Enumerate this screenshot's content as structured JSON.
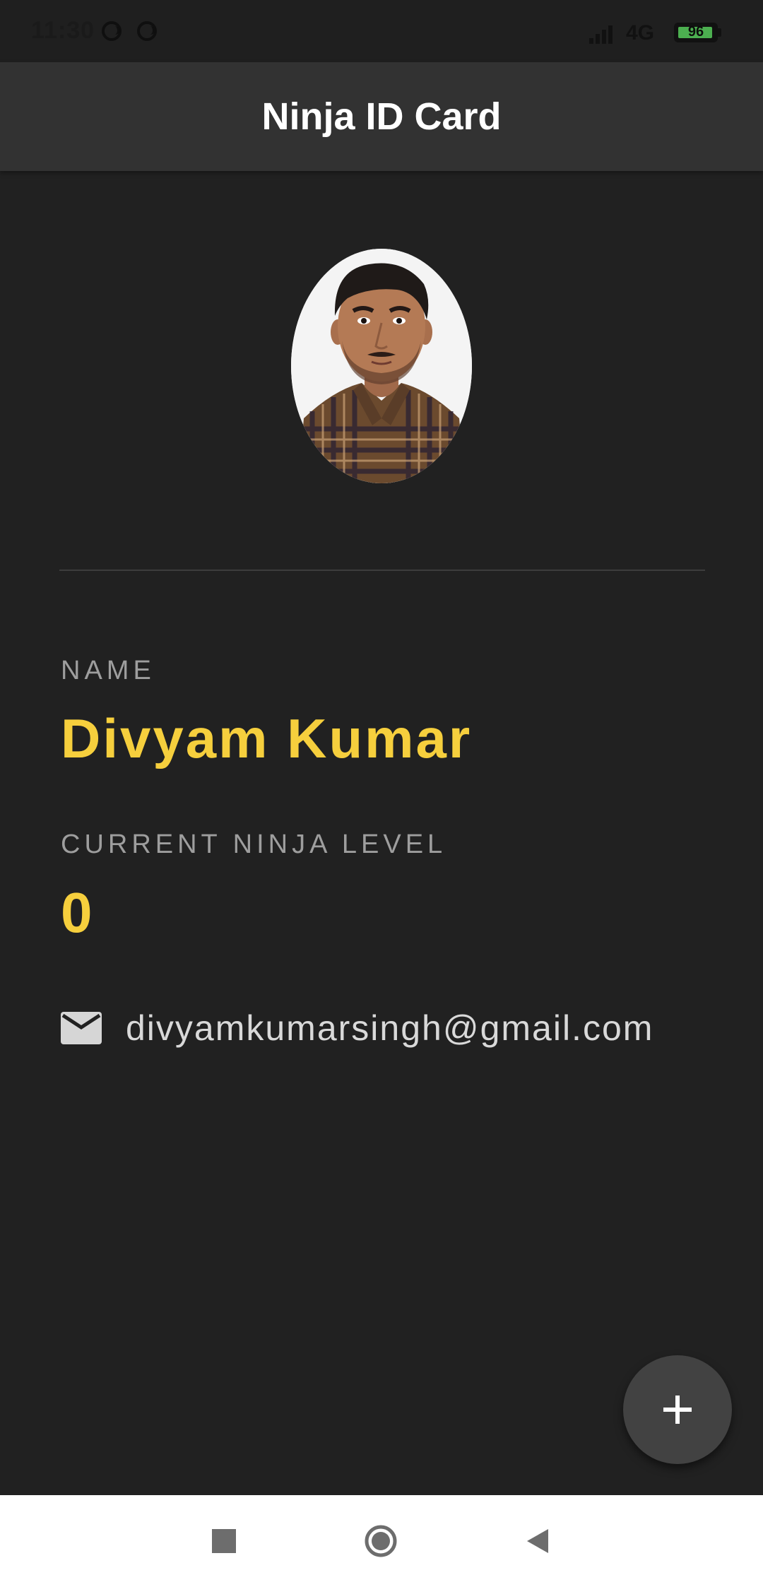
{
  "status_bar": {
    "time": "11:30",
    "network": "4G",
    "battery": "96",
    "battery_level": 0.96
  },
  "app_bar": {
    "title": "Ninja ID Card"
  },
  "profile": {
    "name_label": "NAME",
    "name": "Divyam Kumar",
    "level_label": "CURRENT NINJA LEVEL",
    "level": "0",
    "email": "divyamkumarsingh@gmail.com"
  },
  "colors": {
    "background": "#212121",
    "app_bar": "#323232",
    "accent": "#f6cf3d",
    "label": "#9e9e9e",
    "fab": "#424242"
  },
  "icons": {
    "email": "mail-icon",
    "fab": "add-icon",
    "nav_recents": "square-icon",
    "nav_home": "circle-icon",
    "nav_back": "triangle-back-icon"
  }
}
